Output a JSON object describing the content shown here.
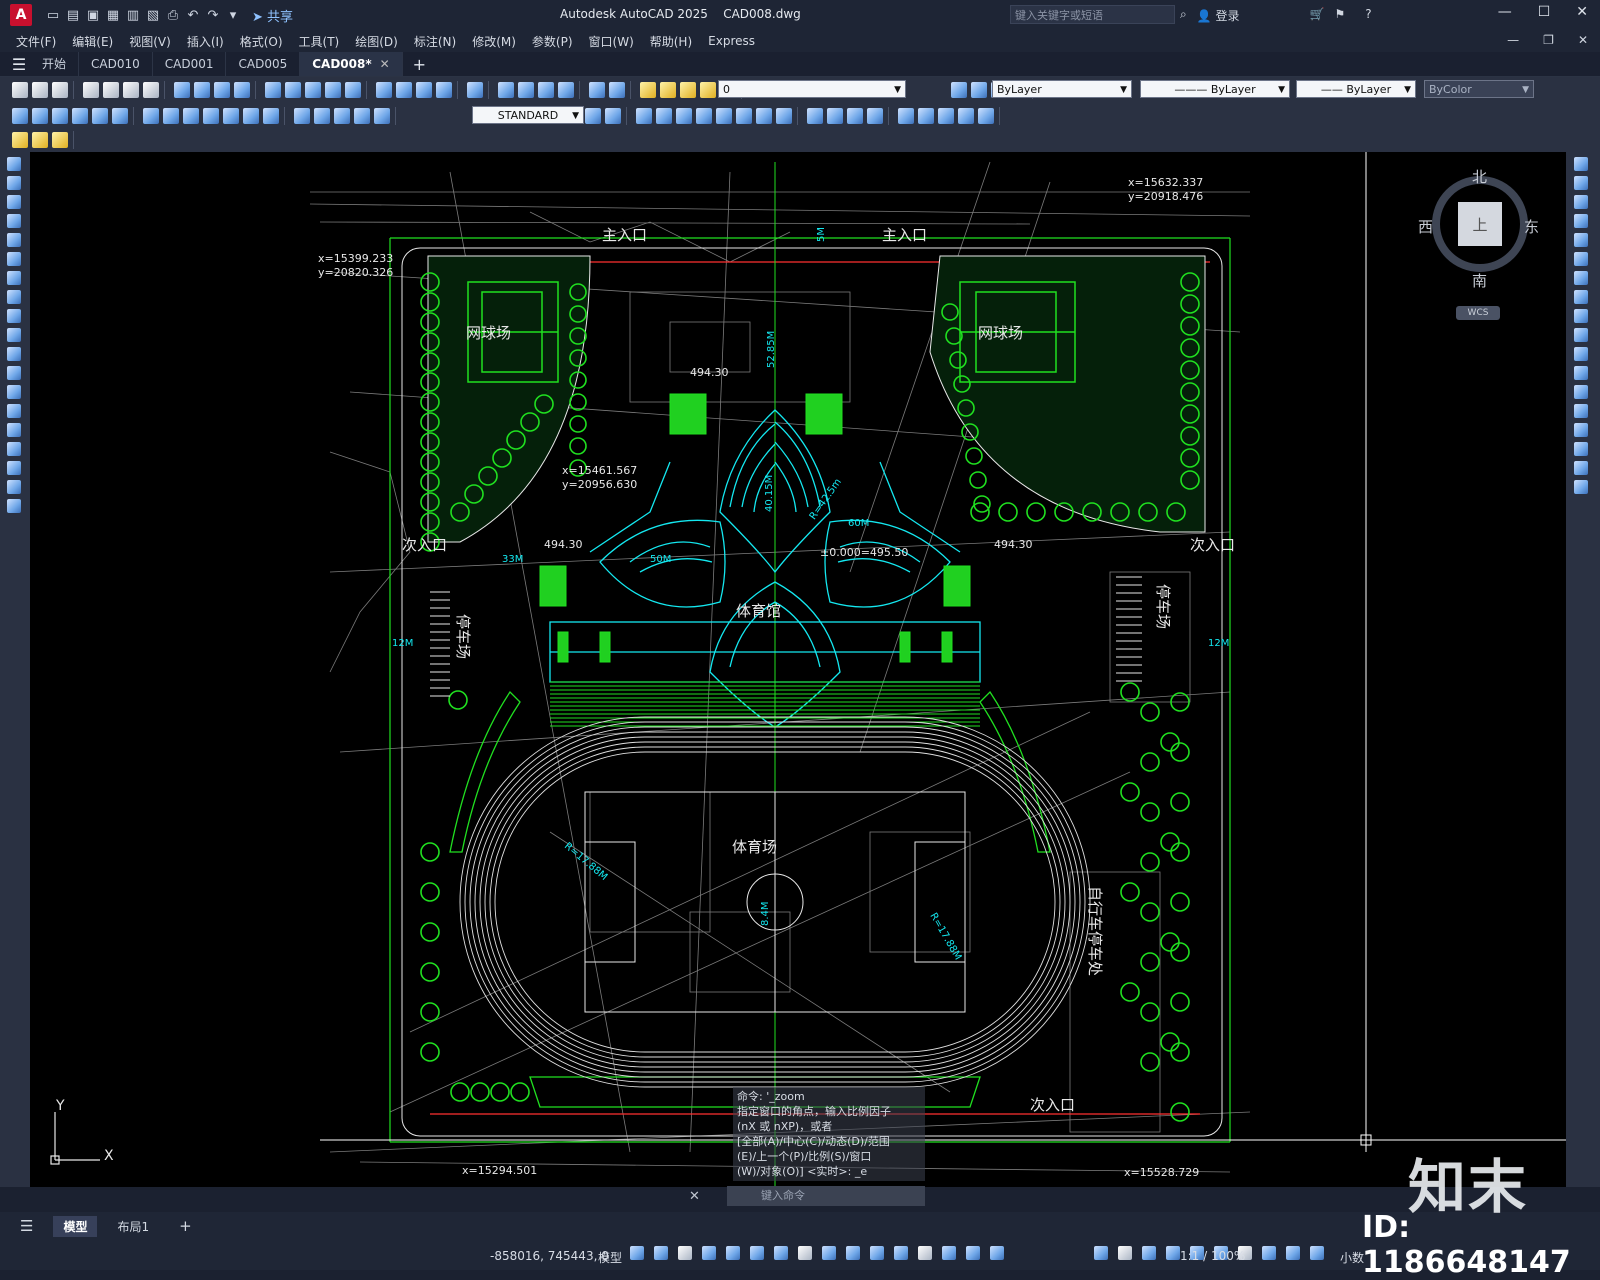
{
  "app": {
    "title": "Autodesk AutoCAD 2025",
    "file": "CAD008.dwg",
    "share_label": "共享",
    "search_placeholder": "键入关键字或短语",
    "login_label": "登录",
    "logo_letter": "A"
  },
  "menu": [
    "文件(F)",
    "编辑(E)",
    "视图(V)",
    "插入(I)",
    "格式(O)",
    "工具(T)",
    "绘图(D)",
    "标注(N)",
    "修改(M)",
    "参数(P)",
    "窗口(W)",
    "帮助(H)",
    "Express"
  ],
  "tabs": [
    {
      "label": "开始",
      "active": false
    },
    {
      "label": "CAD010",
      "active": false
    },
    {
      "label": "CAD001",
      "active": false
    },
    {
      "label": "CAD005",
      "active": false
    },
    {
      "label": "CAD008*",
      "active": true
    }
  ],
  "toolbar": {
    "layer_value": "0",
    "color_value": "ByLayer",
    "linetype_value": "ByLayer",
    "lineweight_value": "ByLayer",
    "plotstyle_value": "ByColor",
    "textstyle_value": "STANDARD"
  },
  "viewcube": {
    "north": "北",
    "south": "南",
    "east": "东",
    "west": "西",
    "face": "上",
    "wcs": "WCS"
  },
  "drawing": {
    "labels": {
      "main_entrance_1": "主入口",
      "main_entrance_2": "主入口",
      "side_entrance_left": "次入口",
      "side_entrance_right": "次入口",
      "side_entrance_bottom": "次入口",
      "tennis_left": "网球场",
      "tennis_right": "网球场",
      "gym": "体育馆",
      "stadium": "体育场",
      "parking_left": "停车场",
      "parking_right": "停车场",
      "bike_parking": "自行车停车处"
    },
    "coords": [
      "x=15632.337",
      "y=20918.476",
      "x=15399.233",
      "y=20820.326",
      "x=15461.567",
      "y=20956.630",
      "x=15294.501",
      "x=15528.729"
    ],
    "dims": [
      "494.30",
      "494.30",
      "494.30",
      "±0.000=495.50",
      "R=42.5m",
      "12M",
      "12M",
      "33M",
      "50M",
      "60M",
      "40.15M",
      "52.85M",
      "R=17.88M",
      "R=17.88M",
      "8.4M",
      "5M"
    ]
  },
  "command": {
    "history": [
      "命令: '_zoom",
      "指定窗口的角点，输入比例因子",
      "(nX 或 nXP)，或者",
      "[全部(A)/中心(C)/动态(D)/范围",
      "(E)/上一个(P)/比例(S)/窗口",
      "(W)/对象(O)] <实时>: _e"
    ],
    "placeholder": "键入命令"
  },
  "layout_tabs": [
    "模型",
    "布局1"
  ],
  "status": {
    "coordinates": "-858016, 745443, 0",
    "mode": "模型",
    "scale": "1:1 / 100%",
    "units": "小数"
  },
  "watermark": {
    "brand": "知末",
    "id": "ID: 1186648147"
  }
}
